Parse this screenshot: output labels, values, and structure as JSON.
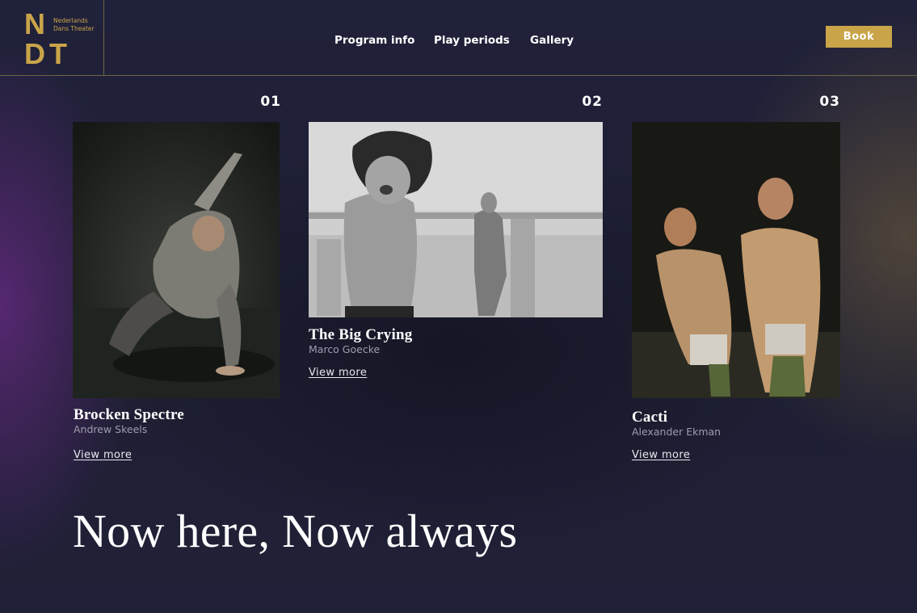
{
  "brand": {
    "logo_top": "N",
    "logo_bottom": "DT",
    "logo_sub_line1": "Nederlands",
    "logo_sub_line2": "Dans Theater",
    "accent_color": "#c9a449"
  },
  "nav": {
    "items": [
      "Program info",
      "Play periods",
      "Gallery"
    ],
    "book_label": "Book"
  },
  "cards": [
    {
      "number": "01",
      "title": "Brocken Spectre",
      "author": "Andrew Skeels",
      "link": "View more",
      "image": "dancer-crouching-photo"
    },
    {
      "number": "02",
      "title": "The Big Crying",
      "author": "Marco Goecke",
      "link": "View more",
      "image": "dancer-screaming-bw-photo"
    },
    {
      "number": "03",
      "title": "Cacti",
      "author": "Alexander Ekman",
      "link": "View more",
      "image": "two-dancers-shouting-photo"
    }
  ],
  "tagline": "Now here, Now always"
}
